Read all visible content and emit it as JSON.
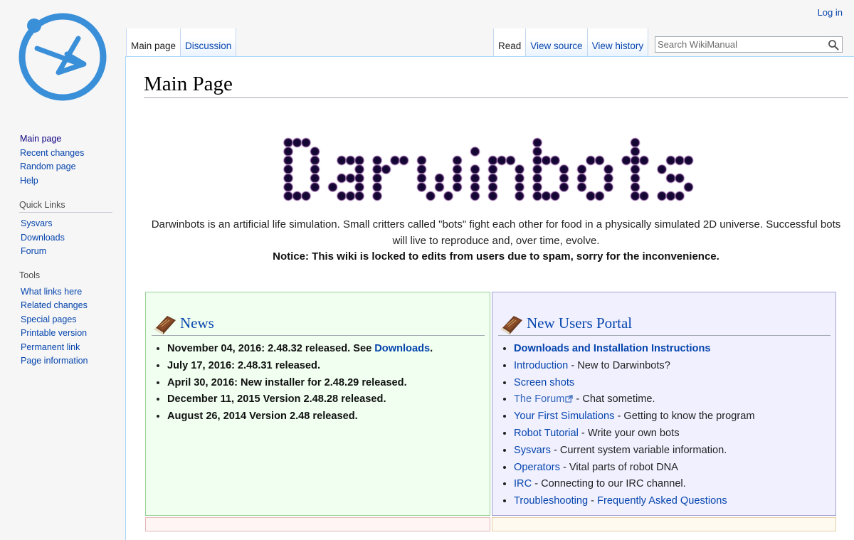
{
  "personal": {
    "login": "Log in"
  },
  "tabs": {
    "main_page": "Main page",
    "discussion": "Discussion",
    "read": "Read",
    "view_source": "View source",
    "view_history": "View history"
  },
  "search": {
    "placeholder": "Search WikiManual",
    "icon": "search-icon"
  },
  "sidebar": {
    "nav": [
      "Main page",
      "Recent changes",
      "Random page",
      "Help"
    ],
    "quick_links_heading": "Quick Links",
    "quick_links": [
      "Sysvars",
      "Downloads",
      "Forum"
    ],
    "tools_heading": "Tools",
    "tools": [
      "What links here",
      "Related changes",
      "Special pages",
      "Printable version",
      "Permanent link",
      "Page information"
    ]
  },
  "page": {
    "title": "Main Page",
    "banner_text": "Darwinbots",
    "intro": "Darwinbots is an artificial life simulation. Small critters called \"bots\" fight each other for food in a physically simulated 2D universe. Successful bots will live to reproduce and, over time, evolve.",
    "notice": "Notice: This wiki is locked to edits from users due to spam, sorry for the inconvenience."
  },
  "news": {
    "title": "News",
    "items": [
      {
        "text": "November 04, 2016: 2.48.32 released. See ",
        "link": "Downloads",
        "tail": "."
      },
      {
        "text": "July 17, 2016: 2.48.31 released."
      },
      {
        "text": "April 30, 2016: New installer for 2.48.29 released."
      },
      {
        "text": "December 11, 2015 Version 2.48.28 released."
      },
      {
        "text": "August 26, 2014 Version 2.48 released."
      }
    ]
  },
  "portal": {
    "title": "New Users Portal",
    "items": [
      {
        "link": "Downloads and Installation Instructions",
        "desc": ""
      },
      {
        "link": "Introduction",
        "desc": " - New to Darwinbots?"
      },
      {
        "link": "Screen shots",
        "desc": ""
      },
      {
        "link": "The Forum",
        "desc": " - Chat sometime."
      },
      {
        "link": "Your First Simulations",
        "desc": " - Getting to know the program"
      },
      {
        "link": "Robot Tutorial",
        "desc": " - Write your own bots"
      },
      {
        "link": "Sysvars",
        "desc": " - Current system variable information."
      },
      {
        "link": "Operators",
        "desc": " - Vital parts of robot DNA"
      },
      {
        "link": "IRC",
        "desc": " - Connecting to our IRC channel."
      },
      {
        "link": "Troubleshooting",
        "desc": " - ",
        "link2": "Frequently Asked Questions"
      }
    ]
  },
  "colors": {
    "link": "#0645ad",
    "news_bg": "#f0fff0",
    "portal_bg": "#f0f0ff",
    "logo": "#3a8fd9"
  }
}
